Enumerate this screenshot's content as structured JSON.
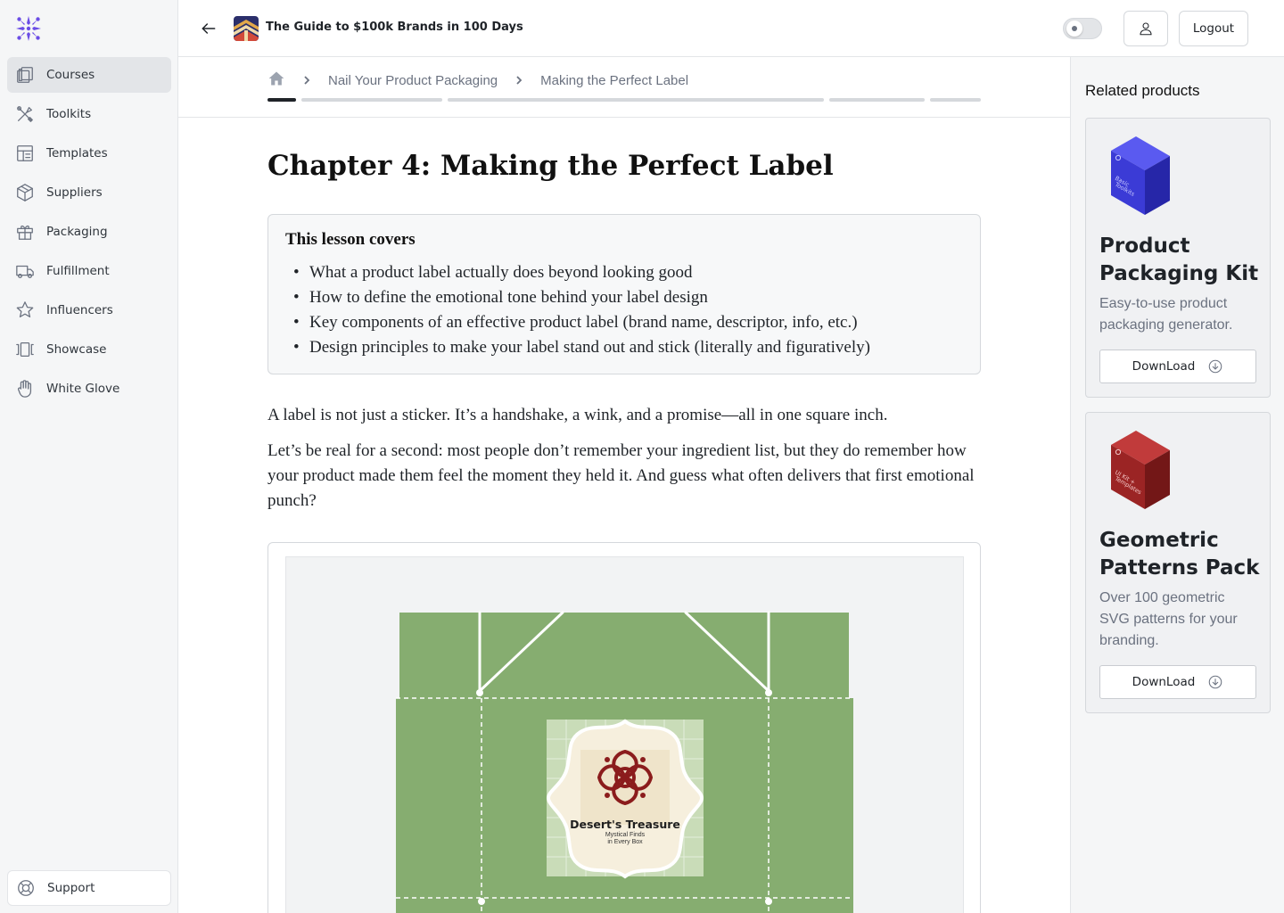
{
  "sidebar": {
    "items": [
      {
        "label": "Courses",
        "icon": "courses-icon",
        "active": true
      },
      {
        "label": "Toolkits",
        "icon": "toolkits-icon"
      },
      {
        "label": "Templates",
        "icon": "templates-icon"
      },
      {
        "label": "Suppliers",
        "icon": "suppliers-icon"
      },
      {
        "label": "Packaging",
        "icon": "packaging-icon"
      },
      {
        "label": "Fulfillment",
        "icon": "fulfillment-icon"
      },
      {
        "label": "Influencers",
        "icon": "influencers-icon"
      },
      {
        "label": "Showcase",
        "icon": "showcase-icon"
      },
      {
        "label": "White Glove",
        "icon": "white-glove-icon"
      }
    ],
    "support_label": "Support"
  },
  "header": {
    "course_title": "The Guide to $100k Brands in 100 Days",
    "logout_label": "Logout"
  },
  "breadcrumb": {
    "items": [
      "Nail Your Product Packaging",
      "Making the Perfect Label"
    ]
  },
  "lesson": {
    "title": "Chapter 4: Making the Perfect Label",
    "covers_heading": "This lesson covers",
    "covers_items": [
      "What a product label actually does beyond looking good",
      "How to define the emotional tone behind your label design",
      "Key components of an effective product label (brand name, descriptor, info, etc.)",
      "Design principles to make your label stand out and stick (literally and figuratively)"
    ],
    "paragraphs": [
      "A label is not just a sticker. It’s a handshake, a wink, and a promise—all in one square inch.",
      "Let’s be real for a second: most people don’t remember your ingredient list, but they do remember how your product made them feel the moment they held it. And guess what often delivers that first emotional punch?"
    ],
    "figure": {
      "label_brand": "Desert's Treasure",
      "label_tagline_1": "Mystical Finds",
      "label_tagline_2": "in Every Box"
    }
  },
  "related": {
    "heading": "Related products",
    "products": [
      {
        "name_1": "Product",
        "name_2": "Packaging Kit",
        "desc_1": "Easy-to-use product",
        "desc_2": "packaging generator.",
        "button": "DownLoad",
        "box_text": "Basic Toolkits",
        "box_color": "#3b3bd6"
      },
      {
        "name_1": "Geometric",
        "name_2": "Patterns Pack",
        "desc_1": "Over 100 geometric",
        "desc_2": "SVG patterns for your",
        "desc_3": "branding.",
        "button": "DownLoad",
        "box_text": "UI Kit + Templates",
        "box_color": "#9b2424"
      }
    ]
  },
  "colors": {
    "accent": "#6b4de6",
    "packaging_green": "#86ad70",
    "label_cream": "#f6efdd",
    "label_maroon": "#8b1c1c"
  }
}
